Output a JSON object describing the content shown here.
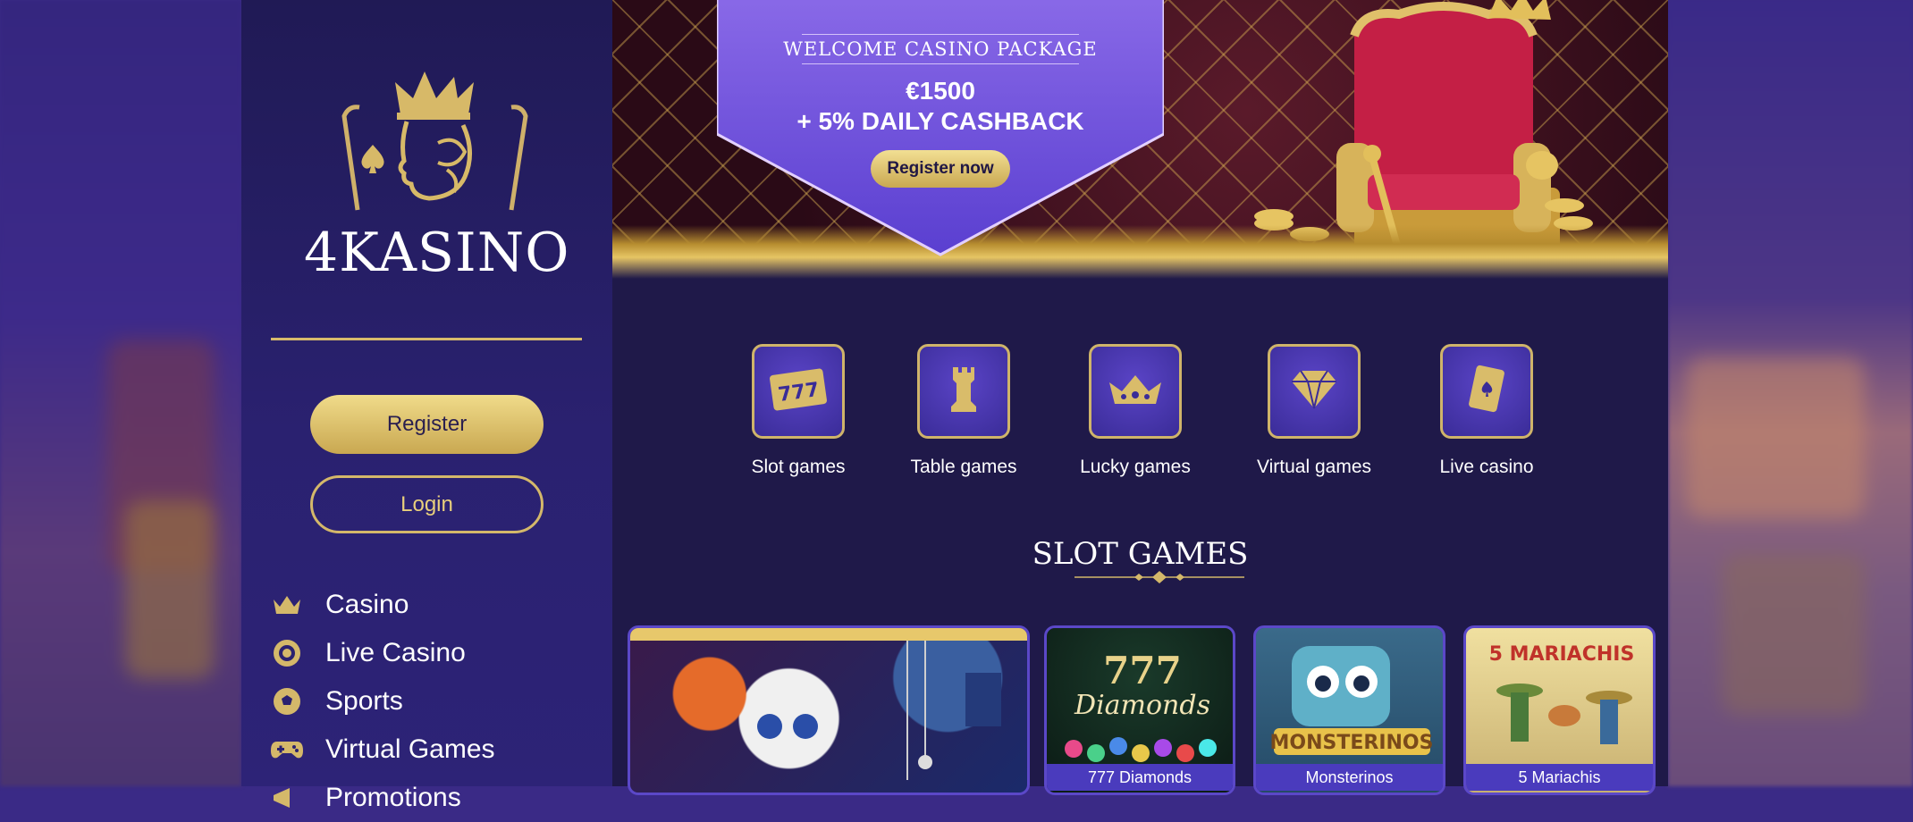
{
  "brand": {
    "name": "4KASINO"
  },
  "sidebar": {
    "register_label": "Register",
    "login_label": "Login",
    "nav": [
      {
        "label": "Casino",
        "icon": "crown-icon"
      },
      {
        "label": "Live Casino",
        "icon": "chip-icon"
      },
      {
        "label": "Sports",
        "icon": "soccer-ball-icon"
      },
      {
        "label": "Virtual Games",
        "icon": "gamepad-icon"
      },
      {
        "label": "Promotions",
        "icon": "megaphone-icon"
      }
    ]
  },
  "hero": {
    "package_title": "WELCOME CASINO PACKAGE",
    "amount": "€1500",
    "cashback": "+ 5% DAILY CASHBACK",
    "cta": "Register now"
  },
  "categories": [
    {
      "label": "Slot games",
      "icon": "slot-777-icon"
    },
    {
      "label": "Table games",
      "icon": "chess-rook-icon"
    },
    {
      "label": "Lucky games",
      "icon": "crown-icon"
    },
    {
      "label": "Virtual games",
      "icon": "diamond-icon"
    },
    {
      "label": "Live casino",
      "icon": "spade-card-icon"
    }
  ],
  "slot_section": {
    "title": "SLOT GAMES",
    "games": [
      {
        "name": ""
      },
      {
        "name": "777 Diamonds"
      },
      {
        "name": "Monsterinos"
      },
      {
        "name": "5 Mariachis"
      }
    ]
  },
  "colors": {
    "gold": "#d4b86a",
    "sidebar": "#241c5e",
    "main": "#1f1949",
    "accent_purple": "#6a4fd8"
  }
}
